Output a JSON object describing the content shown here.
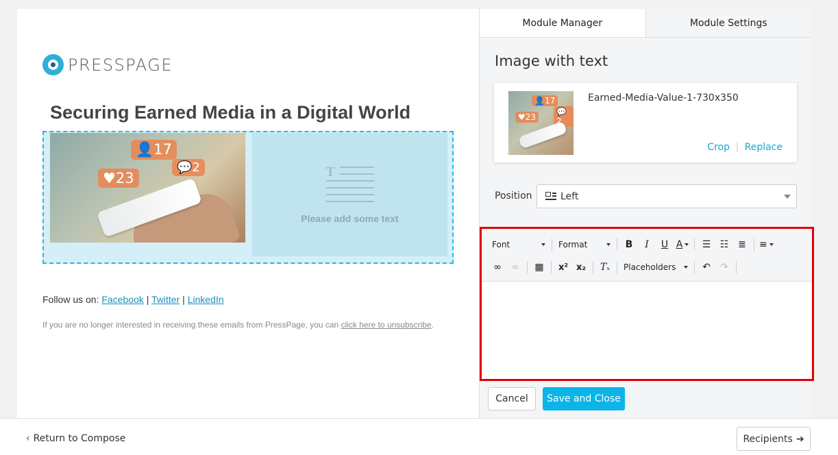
{
  "preview": {
    "logo_text": "PRESSPAGE",
    "email_title": "Securing Earned Media in a Digital World",
    "image_badges": {
      "followers": "17",
      "likes": "23",
      "comments": "2"
    },
    "text_placeholder": "Please add some text",
    "follow_prefix": "Follow us on:",
    "follow_links": [
      "Facebook",
      "Twitter",
      "LinkedIn"
    ],
    "follow_separator": "|",
    "unsubscribe_text": "If you are no longer interested in receiving these emails from PressPage, you can",
    "unsubscribe_link": "click here to unsubscribe",
    "unsubscribe_end": "."
  },
  "panel": {
    "tabs": [
      {
        "label": "Module Manager",
        "active": true
      },
      {
        "label": "Module Settings",
        "active": false
      }
    ],
    "title": "Image with text",
    "image_card": {
      "filename": "Earned-Media-Value-1-730x350",
      "crop_label": "Crop",
      "separator": "|",
      "replace_label": "Replace"
    },
    "position": {
      "label": "Position",
      "value": "Left"
    },
    "toolbar": {
      "font_label": "Font",
      "format_label": "Format",
      "bold": "B",
      "italic": "I",
      "underline": "U",
      "text_color": "A",
      "placeholders_label": "Placeholders"
    },
    "cancel_label": "Cancel",
    "save_label": "Save and Close"
  },
  "footer": {
    "return_label": "Return to Compose",
    "recipients_label": "Recipients"
  },
  "colors": {
    "accent": "#0cb4e8",
    "link": "#1aa5dd",
    "editor_highlight": "#e00000"
  }
}
